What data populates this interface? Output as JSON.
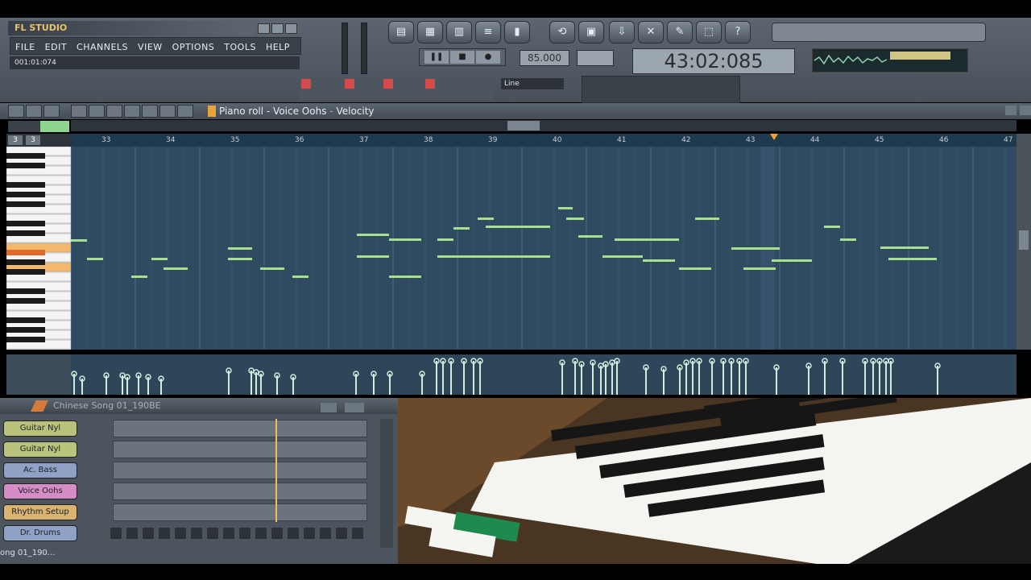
{
  "app": {
    "logo": "FL STUDIO",
    "menu": [
      "FILE",
      "EDIT",
      "CHANNELS",
      "VIEW",
      "OPTIONS",
      "TOOLS",
      "HELP"
    ],
    "hint": "001:01:074",
    "tempo": "85.000",
    "time": "43:02:085",
    "snap": "Line"
  },
  "piano_roll": {
    "title": "Piano roll - Voice Oohs",
    "separator": "-",
    "target": "Velocity",
    "ruler": [
      "33",
      "34",
      "35",
      "36",
      "37",
      "38",
      "39",
      "40",
      "41",
      "42",
      "43",
      "44",
      "45",
      "46",
      "47"
    ]
  },
  "playlist": {
    "title": "Chinese Song 01_190BE",
    "channels": [
      {
        "label": "Guitar Nyl",
        "color": "#b8c27a"
      },
      {
        "label": "Guitar Nyl",
        "color": "#b9c37c"
      },
      {
        "label": "Ac. Bass",
        "color": "#8fa2c6"
      },
      {
        "label": "Voice Oohs",
        "color": "#d48ec5"
      },
      {
        "label": "Rhythm Setup",
        "color": "#d9b36f"
      },
      {
        "label": "Dr. Drums",
        "color": "#8fa2c6"
      }
    ],
    "song": "ong 01_190..."
  },
  "colors": {
    "grid": "#2f4a61",
    "note": "#a6e08c",
    "velocity": "#cfeedd",
    "accent": "#e7c36a"
  },
  "icons": {
    "transport": [
      "pause-icon",
      "stop-icon",
      "record-icon"
    ],
    "top_buttons": [
      "playlist-icon",
      "step-seq-icon",
      "piano-roll-icon",
      "browser-icon",
      "mixer-icon",
      "undo-icon",
      "save-icon",
      "export-icon",
      "cut-icon",
      "tools-icon",
      "render-icon",
      "help-icon"
    ]
  }
}
